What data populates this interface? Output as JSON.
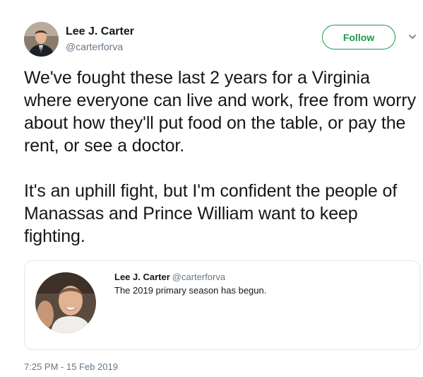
{
  "author": {
    "name": "Lee J. Carter",
    "handle": "@carterforva"
  },
  "follow_label": "Follow",
  "tweet": {
    "paragraphs": [
      "We've fought these last 2 years for a Virginia where everyone can live and work, free from worry about how they'll put food on the table, or pay the rent, or see a doctor.",
      "It's an uphill fight, but I'm confident the people of Manassas and Prince William want to keep fighting."
    ]
  },
  "quoted_tweet": {
    "name": "Lee J. Carter",
    "handle": "@carterforva",
    "text": "The 2019 primary season has begun."
  },
  "timestamp": "7:25 PM - 15 Feb 2019",
  "colors": {
    "follow_accent": "#1b9a4d",
    "secondary_text": "#657786",
    "border": "#e1e8ed"
  }
}
